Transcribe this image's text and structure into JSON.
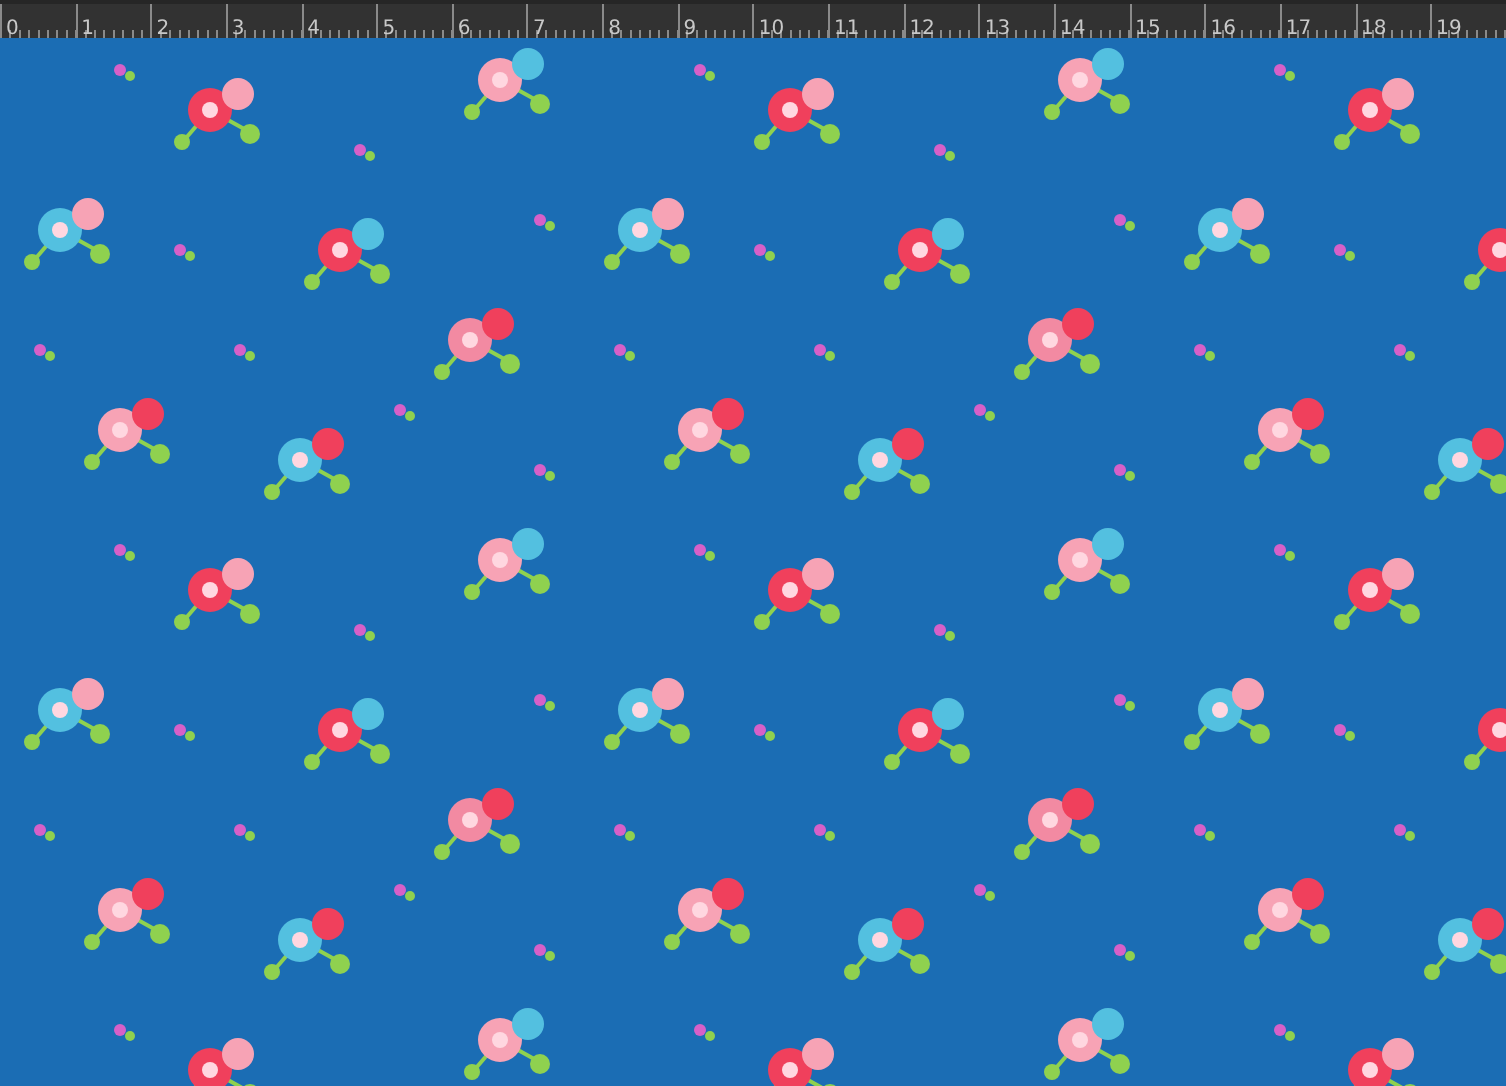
{
  "ruler": {
    "labels": [
      "0",
      "1",
      "2",
      "3",
      "4",
      "5",
      "6",
      "7",
      "8",
      "9",
      "10",
      "11",
      "12",
      "13",
      "14",
      "15",
      "16",
      "17",
      "18",
      "19"
    ]
  }
}
